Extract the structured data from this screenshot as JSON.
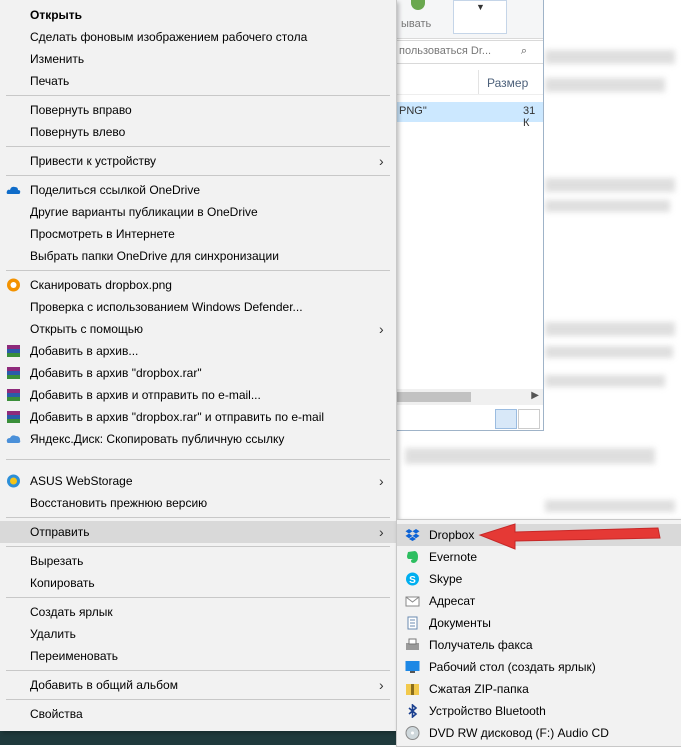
{
  "explorer": {
    "ribbon_label": "ывать",
    "search_placeholder": "пользоваться Dr...",
    "column_size": "Размер",
    "file_name": "PNG\"",
    "file_size": "31 К"
  },
  "menu": {
    "items": [
      {
        "label": "Открыть",
        "icon": "none"
      },
      {
        "label": "Сделать фоновым изображением рабочего стола",
        "icon": "none"
      },
      {
        "label": "Изменить",
        "icon": "none"
      },
      {
        "label": "Печать",
        "icon": "none"
      },
      {
        "label": "Повернуть вправо",
        "icon": "none"
      },
      {
        "label": "Повернуть влево",
        "icon": "none"
      },
      {
        "label": "Привести к устройству",
        "icon": "none"
      },
      {
        "label": "Поделиться ссылкой OneDrive",
        "icon": "onedrive-icon"
      },
      {
        "label": "Другие варианты публикации в OneDrive",
        "icon": "none"
      },
      {
        "label": "Просмотреть в Интернете",
        "icon": "none"
      },
      {
        "label": "Выбрать папки OneDrive для синхронизации",
        "icon": "none"
      },
      {
        "label": "Сканировать dropbox.png",
        "icon": "avast-icon"
      },
      {
        "label": "Проверка с использованием Windows Defender...",
        "icon": "none"
      },
      {
        "label": "Открыть с помощью",
        "icon": "none"
      },
      {
        "label": "Добавить в архив...",
        "icon": "winrar-icon"
      },
      {
        "label": "Добавить в архив \"dropbox.rar\"",
        "icon": "winrar-icon"
      },
      {
        "label": "Добавить в архив и отправить по e-mail...",
        "icon": "winrar-icon"
      },
      {
        "label": "Добавить в архив \"dropbox.rar\" и отправить по e-mail",
        "icon": "winrar-icon"
      },
      {
        "label": "Яндекс.Диск: Скопировать публичную ссылку",
        "icon": "yandex-disk-icon"
      },
      {
        "label": "ASUS WebStorage",
        "icon": "asus-webstorage-icon"
      },
      {
        "label": "Восстановить прежнюю версию",
        "icon": "none"
      },
      {
        "label": "Отправить",
        "icon": "none"
      },
      {
        "label": "Вырезать",
        "icon": "none"
      },
      {
        "label": "Копировать",
        "icon": "none"
      },
      {
        "label": "Создать ярлык",
        "icon": "none"
      },
      {
        "label": "Удалить",
        "icon": "none"
      },
      {
        "label": "Переименовать",
        "icon": "none"
      },
      {
        "label": "Добавить в общий альбом",
        "icon": "none"
      },
      {
        "label": "Свойства",
        "icon": "none"
      }
    ],
    "arrow_glyph": "›"
  },
  "submenu": {
    "items": [
      {
        "label": "Dropbox",
        "icon": "dropbox-icon"
      },
      {
        "label": "Evernote",
        "icon": "evernote-icon"
      },
      {
        "label": "Skype",
        "icon": "skype-icon"
      },
      {
        "label": "Адресат",
        "icon": "mail-recipient-icon"
      },
      {
        "label": "Документы",
        "icon": "documents-icon"
      },
      {
        "label": "Получатель факса",
        "icon": "fax-icon"
      },
      {
        "label": "Рабочий стол (создать ярлык)",
        "icon": "desktop-icon"
      },
      {
        "label": "Сжатая ZIP-папка",
        "icon": "zip-folder-icon"
      },
      {
        "label": "Устройство Bluetooth",
        "icon": "bluetooth-icon"
      },
      {
        "label": "DVD RW дисковод (F:) Audio CD",
        "icon": "dvd-drive-icon"
      }
    ]
  },
  "colors": {
    "menu_bg": "#f2f2f2",
    "highlight": "#d9d9d9",
    "annotation_arrow": "#e53935",
    "selection": "#cce8ff"
  }
}
